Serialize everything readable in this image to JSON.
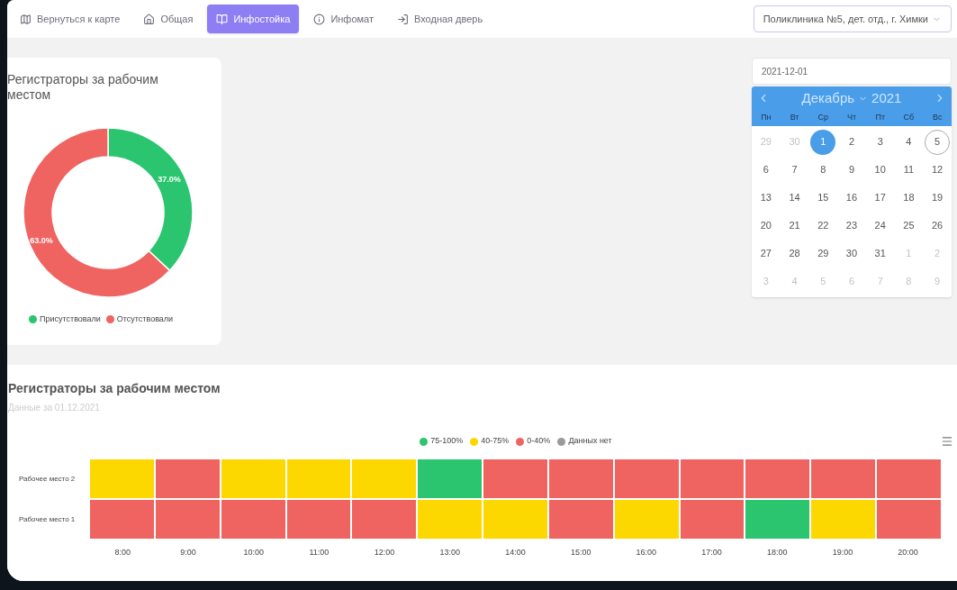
{
  "nav": {
    "items": [
      {
        "label": "Вернуться к карте",
        "selected": false
      },
      {
        "label": "Общая",
        "selected": false
      },
      {
        "label": "Инфостойка",
        "selected": true
      },
      {
        "label": "Инфомат",
        "selected": false
      },
      {
        "label": "Входная дверь",
        "selected": false
      }
    ],
    "clinic_select": {
      "value": "Поликлиника №5, дет. отд., г. Химки"
    }
  },
  "pie_card": {
    "title": "Регистраторы за рабочим местом",
    "chart_data": {
      "type": "donut",
      "values": [
        37,
        63
      ],
      "value_labels": [
        "37.0%",
        "63.0%"
      ]
    },
    "legend": [
      {
        "label": "Присутствовали",
        "color": "#2ac56e"
      },
      {
        "label": "Отсутствовали",
        "color": "#ef6461"
      }
    ]
  },
  "date_picker": {
    "value": "2021-12-01",
    "month": "Декабрь",
    "year": "2021",
    "weekdays": [
      "Пн",
      "Вт",
      "Ср",
      "Чт",
      "Пт",
      "Сб",
      "Вс"
    ],
    "days": [
      {
        "day": "29",
        "other_month": true,
        "selected": false,
        "today": false
      },
      {
        "day": "30",
        "other_month": true,
        "selected": false,
        "today": false
      },
      {
        "day": "1",
        "other_month": false,
        "selected": true,
        "today": false
      },
      {
        "day": "2",
        "other_month": false,
        "selected": false,
        "today": false
      },
      {
        "day": "3",
        "other_month": false,
        "selected": false,
        "today": false
      },
      {
        "day": "4",
        "other_month": false,
        "selected": false,
        "today": false
      },
      {
        "day": "5",
        "other_month": false,
        "selected": false,
        "today": true
      },
      {
        "day": "6",
        "other_month": false,
        "selected": false,
        "today": false
      },
      {
        "day": "7",
        "other_month": false,
        "selected": false,
        "today": false
      },
      {
        "day": "8",
        "other_month": false,
        "selected": false,
        "today": false
      },
      {
        "day": "9",
        "other_month": false,
        "selected": false,
        "today": false
      },
      {
        "day": "10",
        "other_month": false,
        "selected": false,
        "today": false
      },
      {
        "day": "11",
        "other_month": false,
        "selected": false,
        "today": false
      },
      {
        "day": "12",
        "other_month": false,
        "selected": false,
        "today": false
      },
      {
        "day": "13",
        "other_month": false,
        "selected": false,
        "today": false
      },
      {
        "day": "14",
        "other_month": false,
        "selected": false,
        "today": false
      },
      {
        "day": "15",
        "other_month": false,
        "selected": false,
        "today": false
      },
      {
        "day": "16",
        "other_month": false,
        "selected": false,
        "today": false
      },
      {
        "day": "17",
        "other_month": false,
        "selected": false,
        "today": false
      },
      {
        "day": "18",
        "other_month": false,
        "selected": false,
        "today": false
      },
      {
        "day": "19",
        "other_month": false,
        "selected": false,
        "today": false
      },
      {
        "day": "20",
        "other_month": false,
        "selected": false,
        "today": false
      },
      {
        "day": "21",
        "other_month": false,
        "selected": false,
        "today": false
      },
      {
        "day": "22",
        "other_month": false,
        "selected": false,
        "today": false
      },
      {
        "day": "23",
        "other_month": false,
        "selected": false,
        "today": false
      },
      {
        "day": "24",
        "other_month": false,
        "selected": false,
        "today": false
      },
      {
        "day": "25",
        "other_month": false,
        "selected": false,
        "today": false
      },
      {
        "day": "26",
        "other_month": false,
        "selected": false,
        "today": false
      },
      {
        "day": "27",
        "other_month": false,
        "selected": false,
        "today": false
      },
      {
        "day": "28",
        "other_month": false,
        "selected": false,
        "today": false
      },
      {
        "day": "29",
        "other_month": false,
        "selected": false,
        "today": false
      },
      {
        "day": "30",
        "other_month": false,
        "selected": false,
        "today": false
      },
      {
        "day": "31",
        "other_month": false,
        "selected": false,
        "today": false
      },
      {
        "day": "1",
        "other_month": true,
        "selected": false,
        "today": false
      },
      {
        "day": "2",
        "other_month": true,
        "selected": false,
        "today": false
      },
      {
        "day": "3",
        "other_month": true,
        "selected": false,
        "today": false
      },
      {
        "day": "4",
        "other_month": true,
        "selected": false,
        "today": false
      },
      {
        "day": "5",
        "other_month": true,
        "selected": false,
        "today": false
      },
      {
        "day": "6",
        "other_month": true,
        "selected": false,
        "today": false
      },
      {
        "day": "7",
        "other_month": true,
        "selected": false,
        "today": false
      },
      {
        "day": "8",
        "other_month": true,
        "selected": false,
        "today": false
      },
      {
        "day": "9",
        "other_month": true,
        "selected": false,
        "today": false
      }
    ]
  },
  "heatmap": {
    "title": "Регистраторы за рабочим местом",
    "subtitle": "Данные за 01.12.2021",
    "legend": [
      {
        "label": "75-100%",
        "color": "#2ac56e"
      },
      {
        "label": "40-75%",
        "color": "#fcd800"
      },
      {
        "label": "0-40%",
        "color": "#ef6461"
      },
      {
        "label": "Данных нет",
        "color": "#9a9a9a"
      }
    ],
    "rows": [
      {
        "label": "Рабочее место 2",
        "cells": [
          {
            "color": "#fcd800"
          },
          {
            "color": "#ef6461"
          },
          {
            "color": "#fcd800"
          },
          {
            "color": "#fcd800"
          },
          {
            "color": "#fcd800"
          },
          {
            "color": "#2ac56e"
          },
          {
            "color": "#ef6461"
          },
          {
            "color": "#ef6461"
          },
          {
            "color": "#ef6461"
          },
          {
            "color": "#ef6461"
          },
          {
            "color": "#ef6461"
          },
          {
            "color": "#ef6461"
          },
          {
            "color": "#ef6461"
          }
        ]
      },
      {
        "label": "Рабочее место 1",
        "cells": [
          {
            "color": "#ef6461"
          },
          {
            "color": "#ef6461"
          },
          {
            "color": "#ef6461"
          },
          {
            "color": "#ef6461"
          },
          {
            "color": "#ef6461"
          },
          {
            "color": "#fcd800"
          },
          {
            "color": "#fcd800"
          },
          {
            "color": "#ef6461"
          },
          {
            "color": "#fcd800"
          },
          {
            "color": "#ef6461"
          },
          {
            "color": "#2ac56e"
          },
          {
            "color": "#fcd800"
          },
          {
            "color": "#ef6461"
          }
        ]
      }
    ],
    "hours": [
      "8:00",
      "9:00",
      "10:00",
      "11:00",
      "12:00",
      "13:00",
      "14:00",
      "15:00",
      "16:00",
      "17:00",
      "18:00",
      "19:00",
      "20:00"
    ]
  }
}
